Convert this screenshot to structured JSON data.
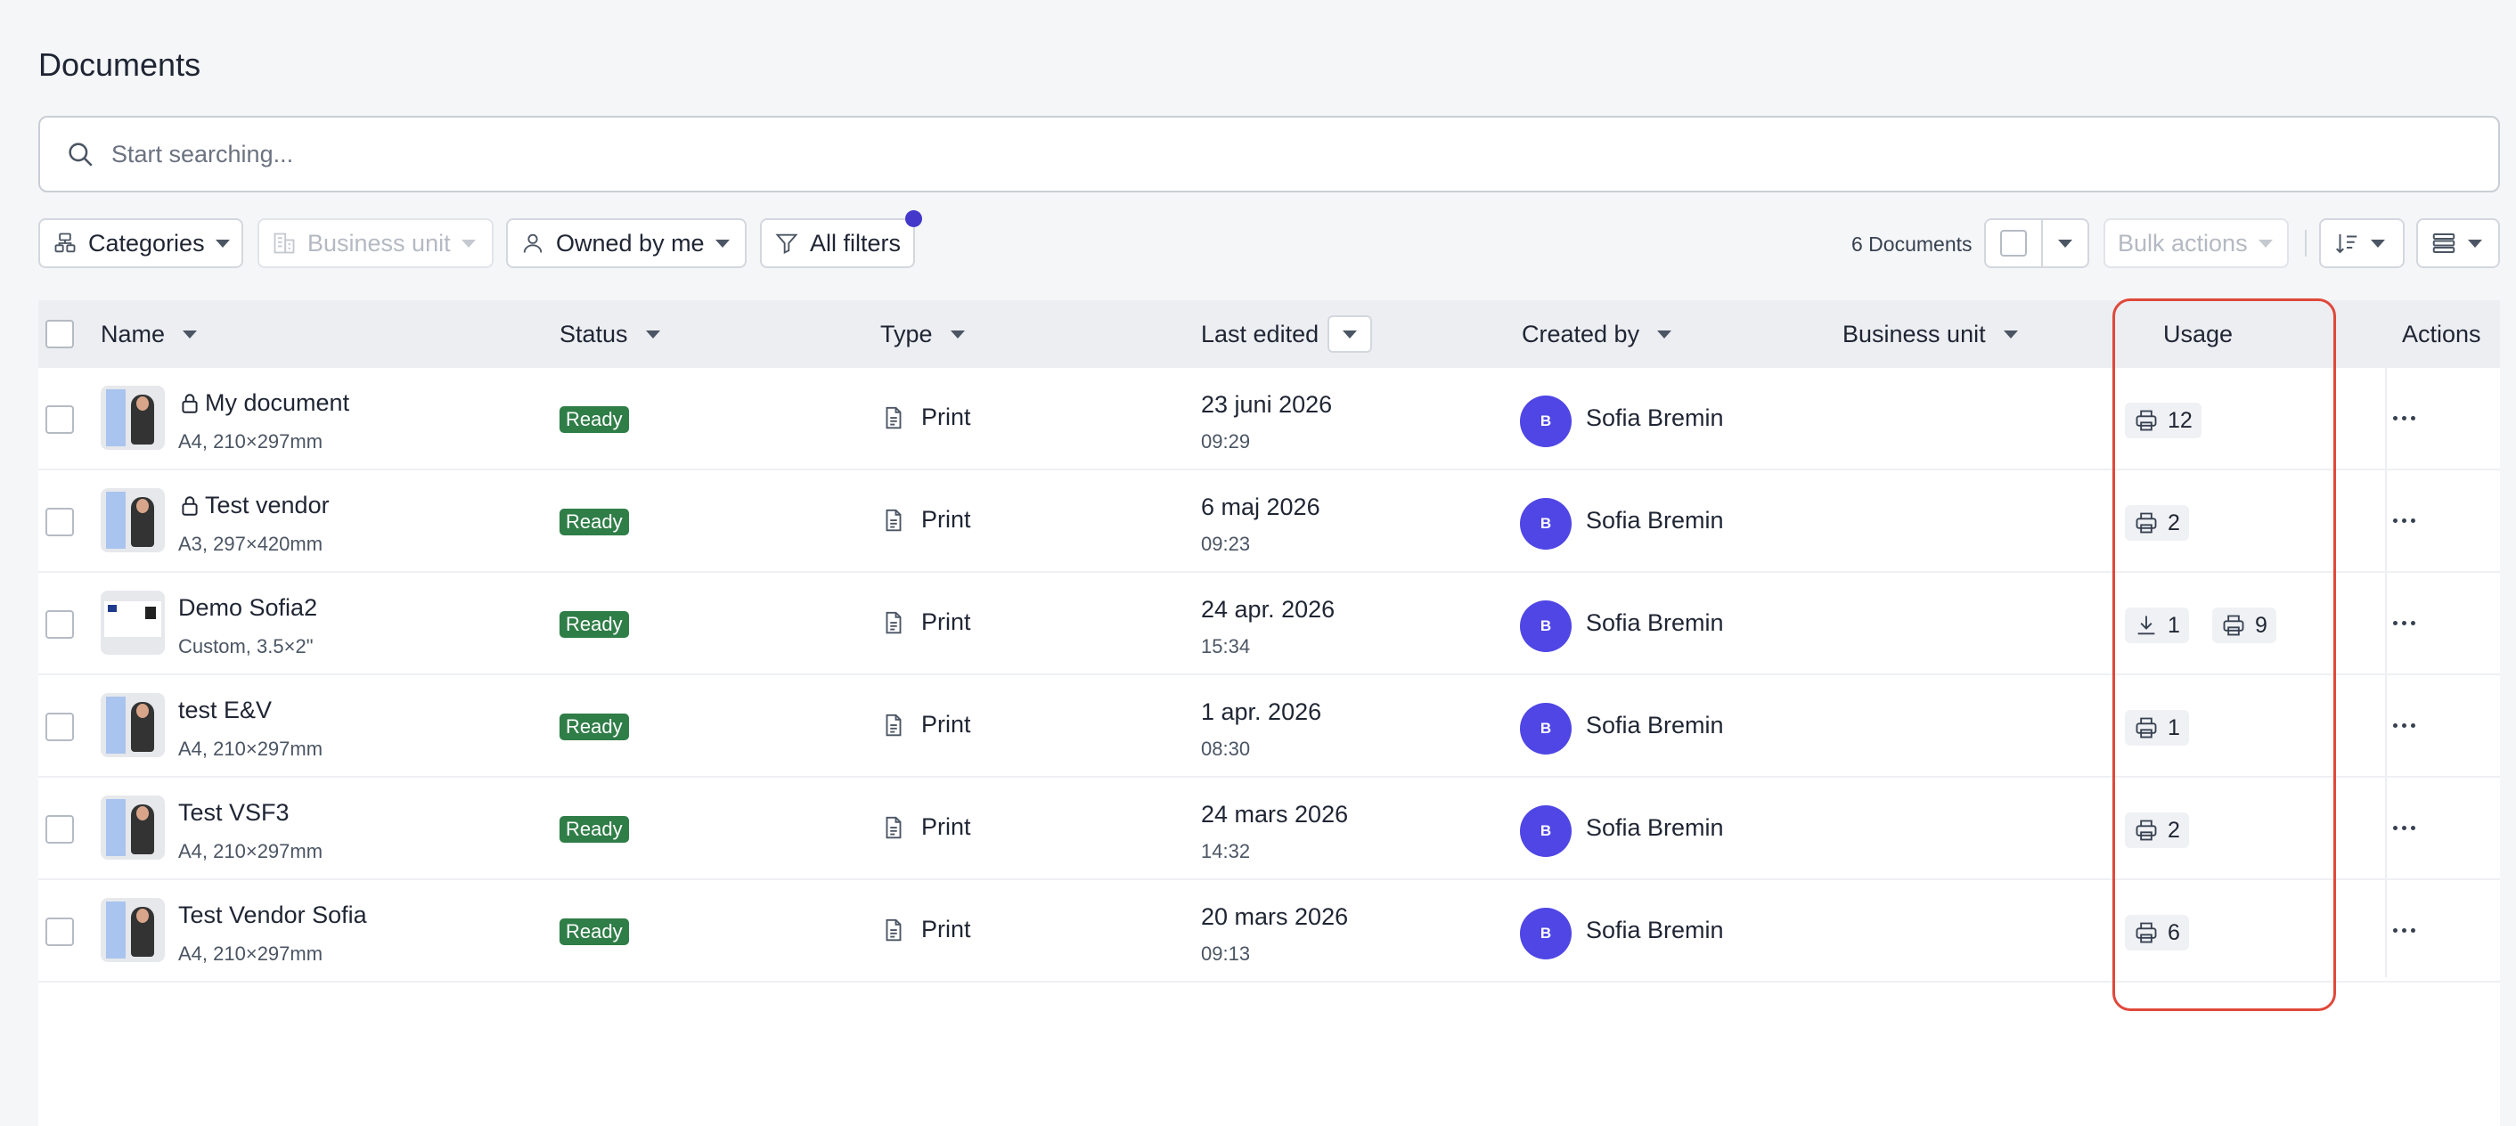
{
  "page_title": "Documents",
  "search": {
    "placeholder": "Start searching..."
  },
  "filters": {
    "categories": "Categories",
    "business_unit": "Business unit",
    "owned_by": "Owned by me",
    "all_filters": "All filters"
  },
  "toolbar": {
    "doc_count": "6 Documents",
    "bulk_actions": "Bulk actions"
  },
  "columns": {
    "name": "Name",
    "status": "Status",
    "type": "Type",
    "last_edited": "Last edited",
    "created_by": "Created by",
    "business_unit": "Business unit",
    "usage": "Usage",
    "actions": "Actions"
  },
  "rows": [
    {
      "name": "My document",
      "locked": true,
      "size": "A4, 210×297mm",
      "status": "Ready",
      "type": "Print",
      "date": "23 juni 2026",
      "time": "09:29",
      "avatar": "B",
      "creator": "Sofia Bremin",
      "usage": [
        {
          "icon": "printer-icon",
          "count": "12"
        }
      ]
    },
    {
      "name": "Test vendor",
      "locked": true,
      "size": "A3, 297×420mm",
      "status": "Ready",
      "type": "Print",
      "date": "6 maj 2026",
      "time": "09:23",
      "avatar": "B",
      "creator": "Sofia Bremin",
      "usage": [
        {
          "icon": "printer-icon",
          "count": "2"
        }
      ]
    },
    {
      "name": "Demo Sofia2",
      "locked": false,
      "size": "Custom, 3.5×2\"",
      "status": "Ready",
      "type": "Print",
      "date": "24 apr. 2026",
      "time": "15:34",
      "avatar": "B",
      "creator": "Sofia Bremin",
      "usage": [
        {
          "icon": "download-icon",
          "count": "1"
        },
        {
          "icon": "printer-icon",
          "count": "9"
        }
      ]
    },
    {
      "name": "test E&V",
      "locked": false,
      "size": "A4, 210×297mm",
      "status": "Ready",
      "type": "Print",
      "date": "1 apr. 2026",
      "time": "08:30",
      "avatar": "B",
      "creator": "Sofia Bremin",
      "usage": [
        {
          "icon": "printer-icon",
          "count": "1"
        }
      ]
    },
    {
      "name": "Test VSF3",
      "locked": false,
      "size": "A4, 210×297mm",
      "status": "Ready",
      "type": "Print",
      "date": "24 mars 2026",
      "time": "14:32",
      "avatar": "B",
      "creator": "Sofia Bremin",
      "usage": [
        {
          "icon": "printer-icon",
          "count": "2"
        }
      ]
    },
    {
      "name": "Test Vendor Sofia",
      "locked": false,
      "size": "A4, 210×297mm",
      "status": "Ready",
      "type": "Print",
      "date": "20 mars 2026",
      "time": "09:13",
      "avatar": "B",
      "creator": "Sofia Bremin",
      "usage": [
        {
          "icon": "printer-icon",
          "count": "6"
        }
      ]
    }
  ],
  "colors": {
    "accent": "#4f46e5",
    "ready": "#2f7d47",
    "highlight": "#e0483a"
  }
}
